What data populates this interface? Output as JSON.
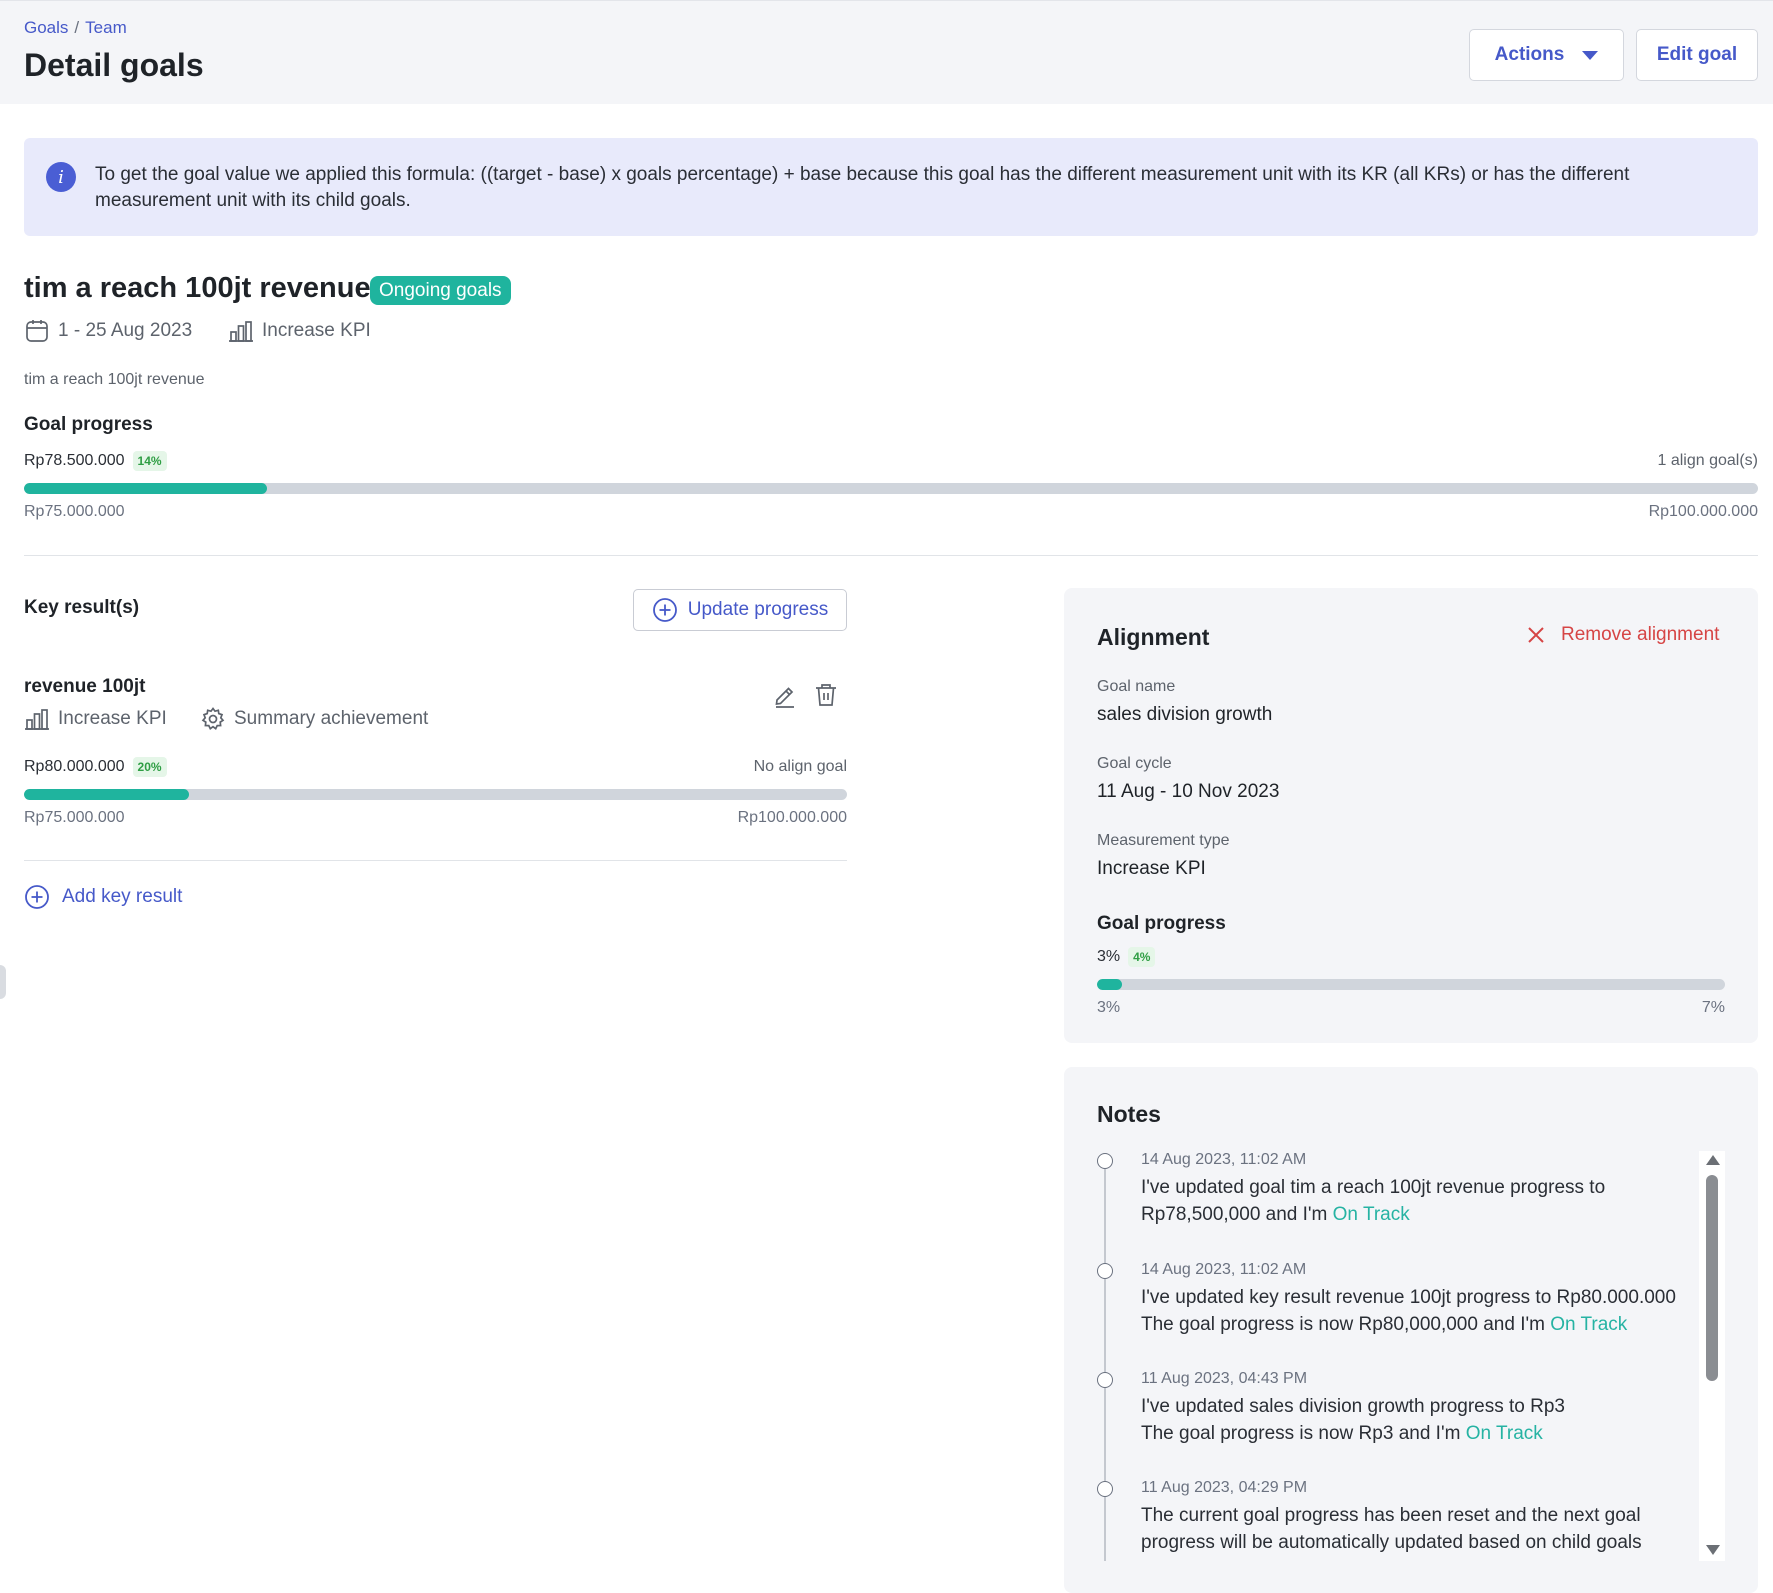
{
  "breadcrumb": {
    "root": "Goals",
    "separator": "/",
    "current": "Team"
  },
  "header": {
    "title": "Detail goals",
    "actions_label": "Actions",
    "edit_label": "Edit goal"
  },
  "info_banner": {
    "icon": "info-icon",
    "text": "To get the goal value we applied this formula: ((target - base) x goals percentage) + base because this goal has the different measurement unit with its KR (all KRs) or has the different measurement unit with its child goals."
  },
  "goal": {
    "title": "tim a reach 100jt revenue",
    "status": "Ongoing goals",
    "date_range": "1 - 25 Aug 2023",
    "measurement": "Increase KPI",
    "description": "tim a reach 100jt revenue",
    "progress": {
      "label": "Goal progress",
      "current": "Rp78.500.000",
      "percent_label": "14%",
      "fraction": 0.14,
      "align_count": "1 align goal(s)",
      "min": "Rp75.000.000",
      "max": "Rp100.000.000"
    }
  },
  "key_results": {
    "title": "Key result(s)",
    "update_label": "Update progress",
    "add_label": "Add key result",
    "items": [
      {
        "name": "revenue 100jt",
        "measurement": "Increase KPI",
        "summary": "Summary achievement",
        "current": "Rp80.000.000",
        "percent_label": "20%",
        "fraction": 0.2,
        "align": "No align goal",
        "min": "Rp75.000.000",
        "max": "Rp100.000.000"
      }
    ]
  },
  "alignment": {
    "title": "Alignment",
    "remove_label": "Remove alignment",
    "goal_name_label": "Goal name",
    "goal_name": "sales division growth",
    "cycle_label": "Goal cycle",
    "cycle": "11 Aug - 10 Nov 2023",
    "measurement_label": "Measurement type",
    "measurement": "Increase KPI",
    "progress": {
      "label": "Goal progress",
      "current": "3%",
      "percent_label": "4%",
      "fraction": 0.04,
      "min": "3%",
      "max": "7%"
    }
  },
  "notes": {
    "title": "Notes",
    "items": [
      {
        "time": "14 Aug 2023, 11:02 AM",
        "line1": "I've updated goal tim a reach 100jt revenue progress to",
        "line2": "Rp78,500,000 and I'm ",
        "status": "On Track"
      },
      {
        "time": "14 Aug 2023, 11:02 AM",
        "line1": "I've updated key result revenue 100jt progress to Rp80.000.000",
        "line2": "The goal progress is now Rp80,000,000 and I'm ",
        "status": "On Track"
      },
      {
        "time": "11 Aug 2023, 04:43 PM",
        "line1": "I've updated sales division growth progress to Rp3",
        "line2": "The goal progress is now Rp3 and I'm ",
        "status": "On Track"
      },
      {
        "time": "11 Aug 2023, 04:29 PM",
        "line1": "The current goal progress has been reset and the next goal",
        "line2": "progress will be automatically updated based on child goals",
        "status": ""
      }
    ]
  },
  "colors": {
    "accent": "#4659c9",
    "progress": "#1fb49e",
    "danger": "#d64545",
    "on_track": "#26b3a3"
  }
}
